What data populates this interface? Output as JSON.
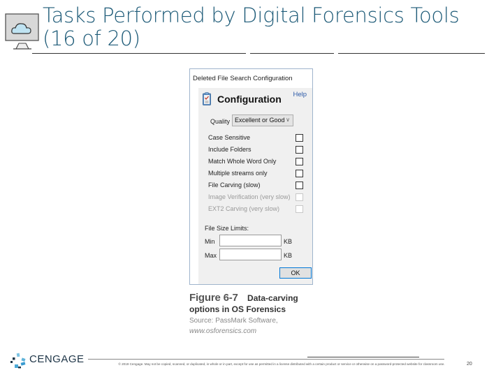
{
  "slide": {
    "title_line1": "Tasks Performed by Digital Forensics Tools",
    "title_line2": "(16 of 20)",
    "title_icon": "monitor-cloud-icon",
    "page_number": "20"
  },
  "dialog": {
    "window_title": "Deleted File Search Configuration",
    "heading": "Configuration",
    "help_label": "Help",
    "quality_label": "Quality",
    "quality_value": "Excellent or Good",
    "options": [
      {
        "label": "Case Sensitive",
        "checked": false,
        "enabled": true
      },
      {
        "label": "Include Folders",
        "checked": false,
        "enabled": true
      },
      {
        "label": "Match Whole Word Only",
        "checked": false,
        "enabled": true
      },
      {
        "label": "Multiple streams only",
        "checked": false,
        "enabled": true
      },
      {
        "label": "File Carving (slow)",
        "checked": false,
        "enabled": true
      },
      {
        "label": "Image Verification (very slow)",
        "checked": false,
        "enabled": false
      },
      {
        "label": "EXT2 Carving (very slow)",
        "checked": false,
        "enabled": false
      }
    ],
    "file_size_limits_label": "File Size Limits:",
    "min_label": "Min",
    "max_label": "Max",
    "min_value": "",
    "max_value": "",
    "unit": "KB",
    "ok_label": "OK"
  },
  "caption": {
    "figure_number": "Figure 6-7",
    "text_line1": "Data-carving",
    "text_line2": "options in OS Forensics",
    "source": "Source: PassMark Software,",
    "url": "www.osforensics.com"
  },
  "footer": {
    "brand": "CENGAGE",
    "copyright": "© 2019 Cengage. May not be copied, scanned, or duplicated, in whole or in part, except for use as permitted in a license distributed with a certain product or service or otherwise on a password-protected website for classroom use."
  },
  "colors": {
    "title": "#1e5b78",
    "brand_text": "#1d3446",
    "link": "#2c5aa8"
  }
}
